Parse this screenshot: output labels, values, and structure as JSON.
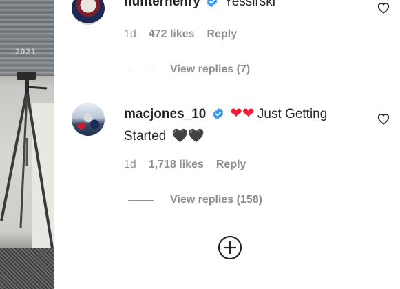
{
  "comments": [
    {
      "username": "hunterhenry",
      "verified": true,
      "text": "Yessirski",
      "time": "1d",
      "likes": "472 likes",
      "reply_label": "Reply",
      "view_replies": "View replies (7)"
    },
    {
      "username": "macjones_10",
      "verified": true,
      "text_line1_emoji": "❤❤",
      "text_line1": "Just Getting",
      "text_line2": "Started",
      "text_line2_emoji": "🖤🖤",
      "time": "1d",
      "likes": "1,718 likes",
      "reply_label": "Reply",
      "view_replies": "View replies (158)"
    }
  ],
  "photo": {
    "year_text": "2021"
  },
  "colors": {
    "text": "#262626",
    "meta": "#8e8e8e",
    "verified": "#3897f0",
    "heart_red": "#ed1c34"
  }
}
